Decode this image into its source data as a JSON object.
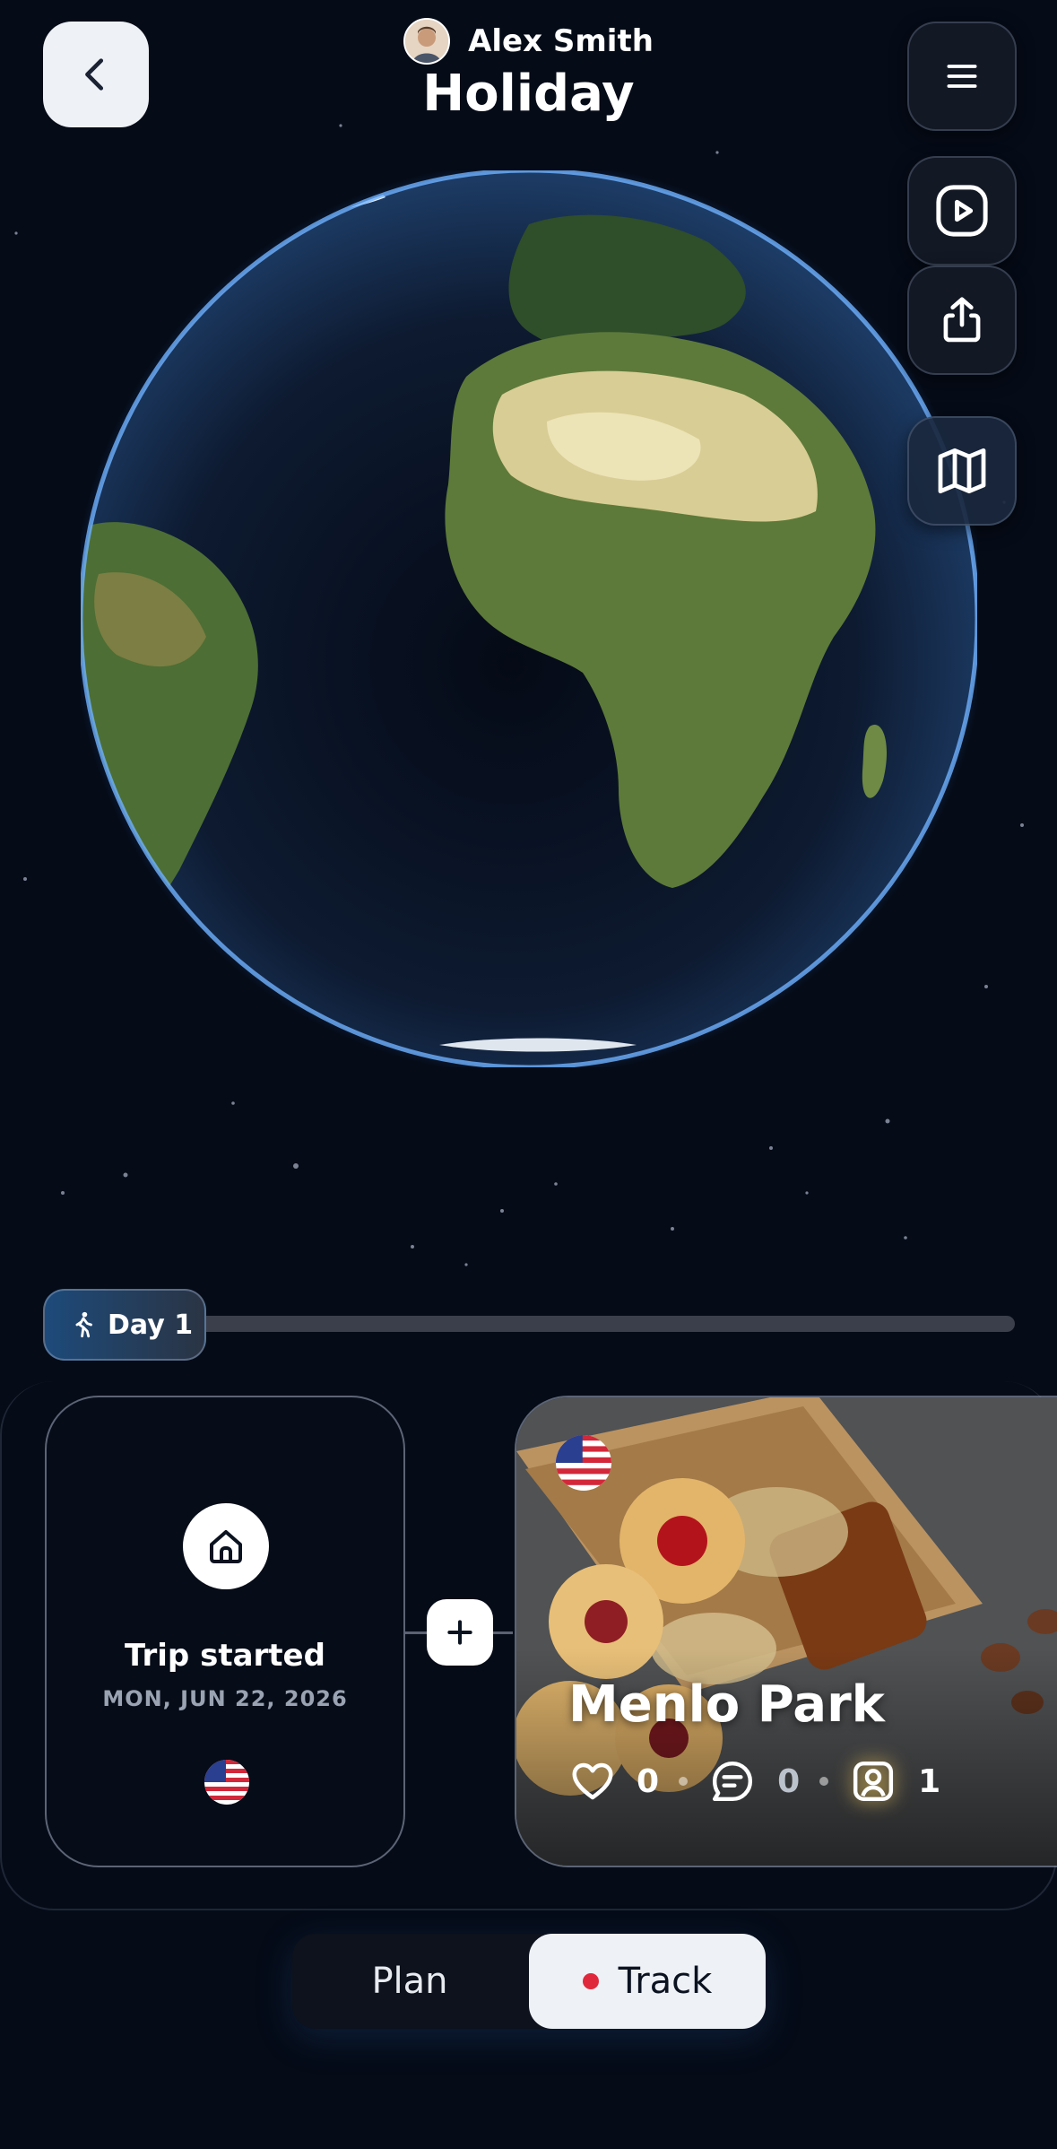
{
  "header": {
    "user_name": "Alex Smith",
    "title": "Holiday"
  },
  "icons": {
    "back": "chevron-left-icon",
    "menu": "hamburger-menu-icon",
    "play": "play-icon",
    "share": "share-icon",
    "map": "map-icon",
    "walk": "walking-person-icon",
    "home": "home-icon",
    "plus": "plus-icon",
    "heart": "heart-icon",
    "comment": "comment-icon",
    "photo": "photo-icon",
    "flag": "us-flag-icon"
  },
  "timeline": {
    "day_label": "Day 1"
  },
  "trip_start": {
    "title": "Trip started",
    "date": "MON, JUN 22, 2026"
  },
  "place": {
    "name": "Menlo Park",
    "likes": "0",
    "comments": "0",
    "photos": "1"
  },
  "mode_switch": {
    "plan_label": "Plan",
    "track_label": "Track",
    "selected": "Track"
  },
  "colors": {
    "background": "#050b17",
    "accent_red": "#e0283c",
    "globe_glow": "#3a8cff"
  }
}
